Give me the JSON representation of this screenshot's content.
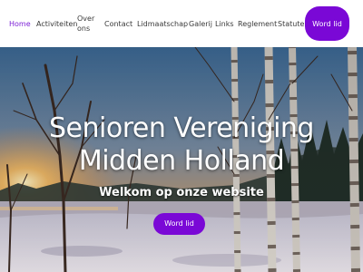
{
  "nav": {
    "items": [
      {
        "label": "Home",
        "active": true
      },
      {
        "label": "Activiteiten"
      },
      {
        "label": "Over ons"
      },
      {
        "label": "Contact"
      },
      {
        "label": "Lidmaatschap"
      },
      {
        "label": "Galerij"
      },
      {
        "label": "Links"
      },
      {
        "label": "Reglement"
      },
      {
        "label": "Statuten"
      }
    ],
    "cta_label": "Word lid"
  },
  "hero": {
    "title_line1": "Senioren Vereniging",
    "title_line2": "Midden Holland",
    "subtitle": "Welkom op onze website",
    "cta_label": "Word lid"
  },
  "colors": {
    "accent": "#7a08d6",
    "nav_active": "#7b1fd6",
    "nav_text": "#3a3a3a"
  }
}
